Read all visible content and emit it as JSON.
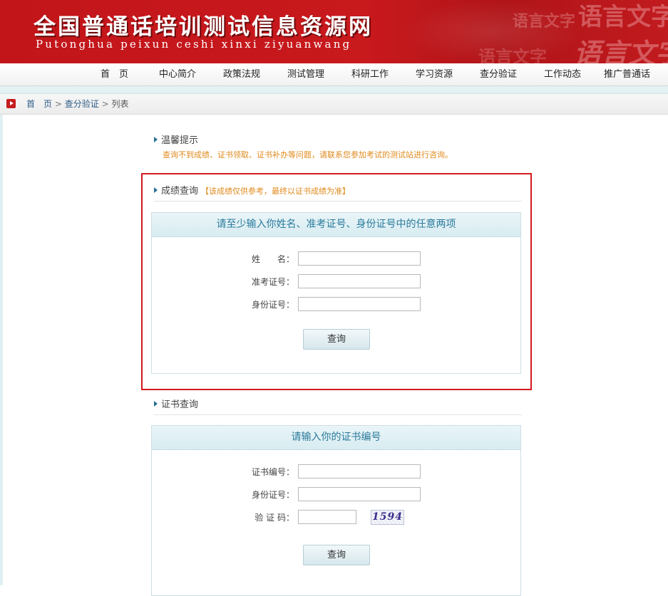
{
  "header": {
    "title": "全国普通话培训测试信息资源网",
    "subtitle": "Putonghua peixun ceshi xinxi ziyuanwang",
    "decoration_text": "语言文字"
  },
  "nav": {
    "items": [
      {
        "label": "首　页"
      },
      {
        "label": "中心简介"
      },
      {
        "label": "政策法规"
      },
      {
        "label": "测试管理"
      },
      {
        "label": "科研工作"
      },
      {
        "label": "学习资源"
      },
      {
        "label": "查分验证"
      },
      {
        "label": "工作动态"
      },
      {
        "label": "推广普通话"
      }
    ]
  },
  "breadcrumb": {
    "home": "首　页",
    "section": "查分验证",
    "current": "列表",
    "separator": ">"
  },
  "tips": {
    "title": "温馨提示",
    "body": "查询不到成绩、证书领取、证书补办等问题，请联系您参加考试的测试站进行咨询。"
  },
  "score_query": {
    "title": "成绩查询",
    "note": "【该成绩仅供参考，最终以证书成绩为准】",
    "instruction": "请至少输入你姓名、准考证号、身份证号中的任意两项",
    "fields": {
      "name_label": "姓　　名：",
      "name_value": "",
      "ticket_label": "准考证号：",
      "ticket_value": "",
      "id_label": "身份证号：",
      "id_value": ""
    },
    "submit_label": "查询"
  },
  "certificate_query": {
    "title": "证书查询",
    "instruction": "请输入你的证书编号",
    "fields": {
      "cert_label": "证书编号：",
      "cert_value": "",
      "id_label": "身份证号：",
      "id_value": "",
      "captcha_label": "验 证 码：",
      "captcha_value": "",
      "captcha_image_text": "1594"
    },
    "submit_label": "查询"
  },
  "colors": {
    "brand_red": "#c8191d",
    "link_blue": "#2b5a86",
    "panel_title": "#2a7a9c",
    "hint_orange": "#e08a1c"
  }
}
